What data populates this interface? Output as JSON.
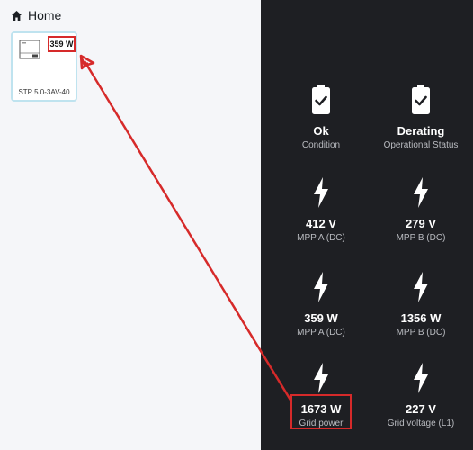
{
  "header": {
    "title": "Home",
    "icon": "home-icon"
  },
  "device_card": {
    "power": "359 W",
    "name": "STP 5.0-3AV-40"
  },
  "status_tiles": [
    {
      "icon": "battery-check-icon",
      "value": "Ok",
      "label": "Condition"
    },
    {
      "icon": "battery-check-icon",
      "value": "Derating",
      "label": "Operational Status"
    }
  ],
  "metric_tiles": [
    {
      "icon": "lightning-icon",
      "value": "412 V",
      "label": "MPP A (DC)"
    },
    {
      "icon": "lightning-icon",
      "value": "279 V",
      "label": "MPP B (DC)"
    },
    {
      "icon": "lightning-icon",
      "value": "359 W",
      "label": "MPP A (DC)"
    },
    {
      "icon": "lightning-icon",
      "value": "1356 W",
      "label": "MPP B (DC)"
    },
    {
      "icon": "lightning-icon",
      "value": "1673 W",
      "label": "Grid power"
    },
    {
      "icon": "lightning-icon",
      "value": "227 V",
      "label": "Grid voltage (L1)"
    }
  ],
  "colors": {
    "accent_red": "#d62a2a",
    "panel_dark": "#1e1f23",
    "card_border": "#bfe3ef"
  }
}
